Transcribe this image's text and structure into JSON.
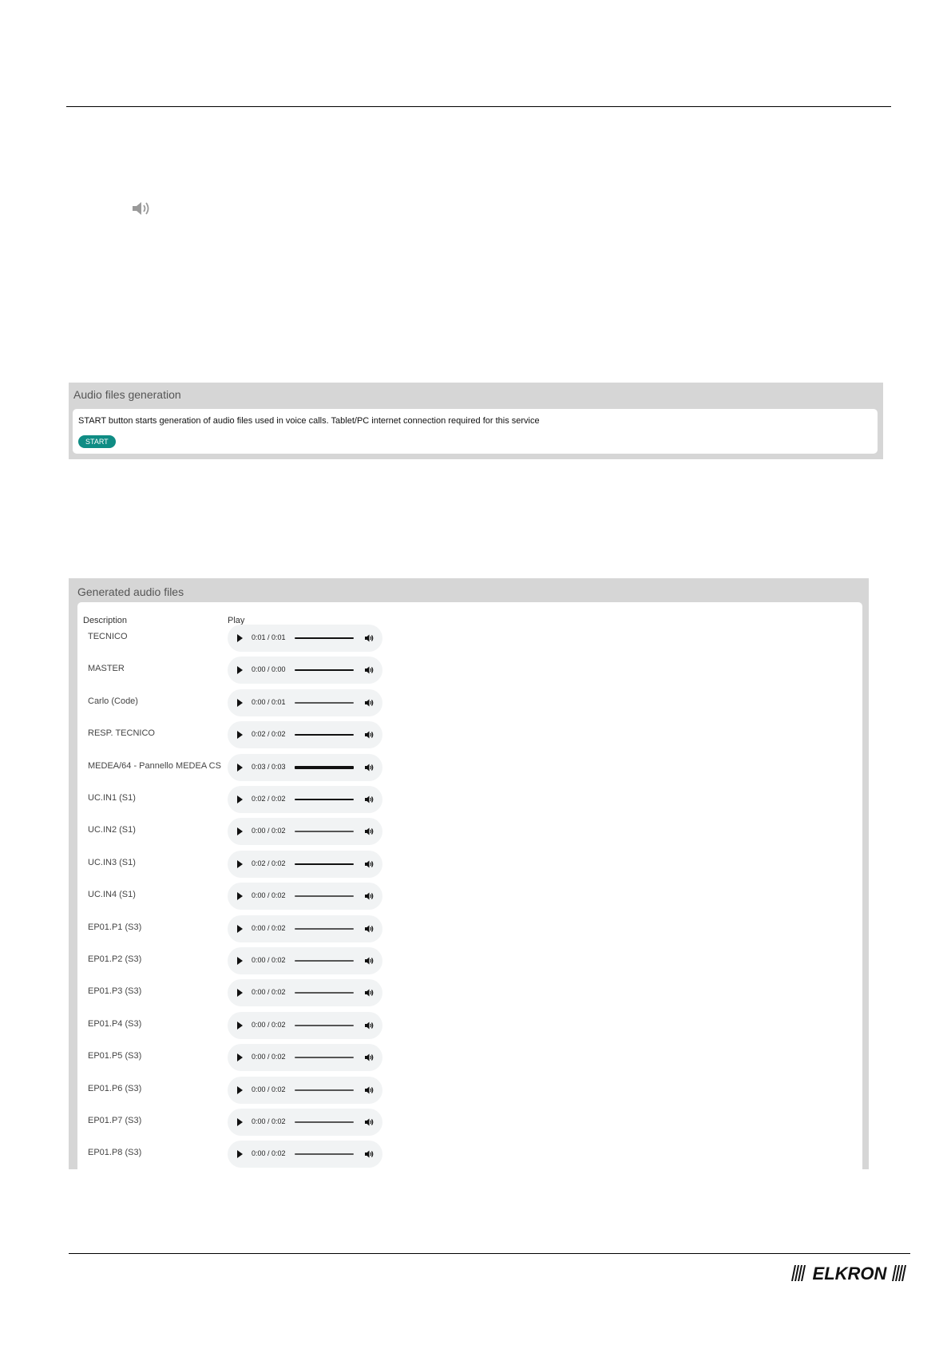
{
  "generation": {
    "title": "Audio files generation",
    "text": "START button starts generation of audio files used in voice calls. Tablet/PC internet connection required for this service",
    "start_label": "START"
  },
  "files": {
    "title": "Generated audio files",
    "col_description": "Description",
    "col_play": "Play",
    "rows": [
      {
        "label": "TECNICO",
        "time": "0:01 / 0:01"
      },
      {
        "label": "MASTER",
        "time": "0:00 / 0:00"
      },
      {
        "label": "Carlo (Code)",
        "time": "0:00 / 0:01"
      },
      {
        "label": "RESP. TECNICO",
        "time": "0:02 / 0:02"
      },
      {
        "label": "MEDEA/64 - Pannello MEDEA CS",
        "time": "0:03 / 0:03"
      },
      {
        "label": "UC.IN1 (S1)",
        "time": "0:02 / 0:02"
      },
      {
        "label": "UC.IN2 (S1)",
        "time": "0:00 / 0:02"
      },
      {
        "label": "UC.IN3 (S1)",
        "time": "0:02 / 0:02"
      },
      {
        "label": "UC.IN4 (S1)",
        "time": "0:00 / 0:02"
      },
      {
        "label": "EP01.P1 (S3)",
        "time": "0:00 / 0:02"
      },
      {
        "label": "EP01.P2 (S3)",
        "time": "0:00 / 0:02"
      },
      {
        "label": "EP01.P3 (S3)",
        "time": "0:00 / 0:02"
      },
      {
        "label": "EP01.P4 (S3)",
        "time": "0:00 / 0:02"
      },
      {
        "label": "EP01.P5 (S3)",
        "time": "0:00 / 0:02"
      },
      {
        "label": "EP01.P6 (S3)",
        "time": "0:00 / 0:02"
      },
      {
        "label": "EP01.P7 (S3)",
        "time": "0:00 / 0:02"
      },
      {
        "label": "EP01.P8 (S3)",
        "time": "0:00 / 0:02"
      }
    ]
  },
  "brand": {
    "logo_text": "ELKRON",
    "accent_color": "#0f8c84"
  },
  "icons": {
    "speaker": "speaker-icon",
    "play": "play-icon",
    "volume": "volume-icon"
  }
}
